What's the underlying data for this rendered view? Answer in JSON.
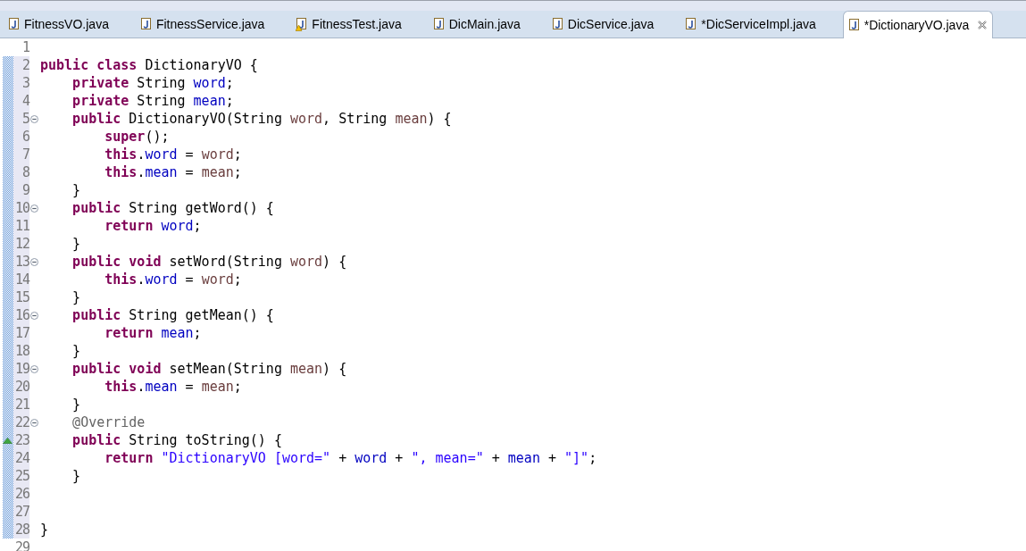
{
  "tabs": [
    {
      "label": "FitnessVO.java",
      "selected": false,
      "warning": false
    },
    {
      "label": "FitnessService.java",
      "selected": false,
      "warning": false
    },
    {
      "label": "FitnessTest.java",
      "selected": false,
      "warning": true
    },
    {
      "label": "DicMain.java",
      "selected": false,
      "warning": false
    },
    {
      "label": "DicService.java",
      "selected": false,
      "warning": false
    },
    {
      "label": "*DicServiceImpl.java",
      "selected": false,
      "warning": false
    },
    {
      "label": "*DictionaryVO.java",
      "selected": true,
      "warning": false
    }
  ],
  "editor": {
    "lines": [
      {
        "number": "1",
        "changed": false,
        "foldable": false,
        "override": false
      },
      {
        "number": "2",
        "changed": true,
        "foldable": false,
        "override": false,
        "tokens": [
          {
            "kind": "keyword",
            "text": "public class"
          },
          {
            "kind": "plain",
            "text": " DictionaryVO {"
          }
        ]
      },
      {
        "number": "3",
        "changed": true,
        "foldable": false,
        "override": false,
        "tokens": [
          {
            "kind": "keyword",
            "text": "    private"
          },
          {
            "kind": "plain",
            "text": " String "
          },
          {
            "kind": "field",
            "text": "word"
          },
          {
            "kind": "plain",
            "text": ";"
          }
        ]
      },
      {
        "number": "4",
        "changed": true,
        "foldable": false,
        "override": false,
        "tokens": [
          {
            "kind": "keyword",
            "text": "    private"
          },
          {
            "kind": "plain",
            "text": " String "
          },
          {
            "kind": "field",
            "text": "mean"
          },
          {
            "kind": "plain",
            "text": ";"
          }
        ]
      },
      {
        "number": "5",
        "changed": true,
        "foldable": true,
        "override": false,
        "tokens": [
          {
            "kind": "keyword",
            "text": "    public"
          },
          {
            "kind": "plain",
            "text": " DictionaryVO(String "
          },
          {
            "kind": "param",
            "text": "word"
          },
          {
            "kind": "plain",
            "text": ", String "
          },
          {
            "kind": "param",
            "text": "mean"
          },
          {
            "kind": "plain",
            "text": ") {"
          }
        ]
      },
      {
        "number": "6",
        "changed": true,
        "foldable": false,
        "override": false,
        "tokens": [
          {
            "kind": "keyword",
            "text": "        super"
          },
          {
            "kind": "plain",
            "text": "();"
          }
        ]
      },
      {
        "number": "7",
        "changed": true,
        "foldable": false,
        "override": false,
        "tokens": [
          {
            "kind": "keyword",
            "text": "        this"
          },
          {
            "kind": "plain",
            "text": "."
          },
          {
            "kind": "field",
            "text": "word"
          },
          {
            "kind": "plain",
            "text": " = "
          },
          {
            "kind": "param",
            "text": "word"
          },
          {
            "kind": "plain",
            "text": ";"
          }
        ]
      },
      {
        "number": "8",
        "changed": true,
        "foldable": false,
        "override": false,
        "tokens": [
          {
            "kind": "keyword",
            "text": "        this"
          },
          {
            "kind": "plain",
            "text": "."
          },
          {
            "kind": "field",
            "text": "mean"
          },
          {
            "kind": "plain",
            "text": " = "
          },
          {
            "kind": "param",
            "text": "mean"
          },
          {
            "kind": "plain",
            "text": ";"
          }
        ]
      },
      {
        "number": "9",
        "changed": true,
        "foldable": false,
        "override": false,
        "tokens": [
          {
            "kind": "plain",
            "text": "    }"
          }
        ]
      },
      {
        "number": "10",
        "changed": true,
        "foldable": true,
        "override": false,
        "tokens": [
          {
            "kind": "keyword",
            "text": "    public"
          },
          {
            "kind": "plain",
            "text": " String getWord() {"
          }
        ]
      },
      {
        "number": "11",
        "changed": true,
        "foldable": false,
        "override": false,
        "tokens": [
          {
            "kind": "keyword",
            "text": "        return"
          },
          {
            "kind": "field",
            "text": " word"
          },
          {
            "kind": "plain",
            "text": ";"
          }
        ]
      },
      {
        "number": "12",
        "changed": true,
        "foldable": false,
        "override": false,
        "tokens": [
          {
            "kind": "plain",
            "text": "    }"
          }
        ]
      },
      {
        "number": "13",
        "changed": true,
        "foldable": true,
        "override": false,
        "tokens": [
          {
            "kind": "keyword",
            "text": "    public void"
          },
          {
            "kind": "plain",
            "text": " setWord(String "
          },
          {
            "kind": "param",
            "text": "word"
          },
          {
            "kind": "plain",
            "text": ") {"
          }
        ]
      },
      {
        "number": "14",
        "changed": true,
        "foldable": false,
        "override": false,
        "tokens": [
          {
            "kind": "keyword",
            "text": "        this"
          },
          {
            "kind": "plain",
            "text": "."
          },
          {
            "kind": "field",
            "text": "word"
          },
          {
            "kind": "plain",
            "text": " = "
          },
          {
            "kind": "param",
            "text": "word"
          },
          {
            "kind": "plain",
            "text": ";"
          }
        ]
      },
      {
        "number": "15",
        "changed": true,
        "foldable": false,
        "override": false,
        "tokens": [
          {
            "kind": "plain",
            "text": "    }"
          }
        ]
      },
      {
        "number": "16",
        "changed": true,
        "foldable": true,
        "override": false,
        "tokens": [
          {
            "kind": "keyword",
            "text": "    public"
          },
          {
            "kind": "plain",
            "text": " String getMean() {"
          }
        ]
      },
      {
        "number": "17",
        "changed": true,
        "foldable": false,
        "override": false,
        "tokens": [
          {
            "kind": "keyword",
            "text": "        return"
          },
          {
            "kind": "field",
            "text": " mean"
          },
          {
            "kind": "plain",
            "text": ";"
          }
        ]
      },
      {
        "number": "18",
        "changed": true,
        "foldable": false,
        "override": false,
        "tokens": [
          {
            "kind": "plain",
            "text": "    }"
          }
        ]
      },
      {
        "number": "19",
        "changed": true,
        "foldable": true,
        "override": false,
        "tokens": [
          {
            "kind": "keyword",
            "text": "    public void"
          },
          {
            "kind": "plain",
            "text": " setMean(String "
          },
          {
            "kind": "param",
            "text": "mean"
          },
          {
            "kind": "plain",
            "text": ") {"
          }
        ]
      },
      {
        "number": "20",
        "changed": true,
        "foldable": false,
        "override": false,
        "tokens": [
          {
            "kind": "keyword",
            "text": "        this"
          },
          {
            "kind": "plain",
            "text": "."
          },
          {
            "kind": "field",
            "text": "mean"
          },
          {
            "kind": "plain",
            "text": " = "
          },
          {
            "kind": "param",
            "text": "mean"
          },
          {
            "kind": "plain",
            "text": ";"
          }
        ]
      },
      {
        "number": "21",
        "changed": true,
        "foldable": false,
        "override": false,
        "tokens": [
          {
            "kind": "plain",
            "text": "    }"
          }
        ]
      },
      {
        "number": "22",
        "changed": true,
        "foldable": true,
        "override": false,
        "tokens": [
          {
            "kind": "annotation",
            "text": "    @Override"
          }
        ]
      },
      {
        "number": "23",
        "changed": true,
        "foldable": false,
        "override": true,
        "tokens": [
          {
            "kind": "keyword",
            "text": "    public"
          },
          {
            "kind": "plain",
            "text": " String toString() {"
          }
        ]
      },
      {
        "number": "24",
        "changed": true,
        "foldable": false,
        "override": false,
        "tokens": [
          {
            "kind": "keyword",
            "text": "        return"
          },
          {
            "kind": "string",
            "text": " \"DictionaryVO [word=\""
          },
          {
            "kind": "plain",
            "text": " + "
          },
          {
            "kind": "field",
            "text": "word"
          },
          {
            "kind": "plain",
            "text": " + "
          },
          {
            "kind": "string",
            "text": "\", mean=\""
          },
          {
            "kind": "plain",
            "text": " + "
          },
          {
            "kind": "field",
            "text": "mean"
          },
          {
            "kind": "plain",
            "text": " + "
          },
          {
            "kind": "string",
            "text": "\"]\""
          },
          {
            "kind": "plain",
            "text": ";"
          }
        ]
      },
      {
        "number": "25",
        "changed": true,
        "foldable": false,
        "override": false,
        "tokens": [
          {
            "kind": "plain",
            "text": "    }"
          }
        ]
      },
      {
        "number": "26",
        "changed": true,
        "foldable": false,
        "override": false
      },
      {
        "number": "27",
        "changed": true,
        "foldable": false,
        "override": false
      },
      {
        "number": "28",
        "changed": true,
        "foldable": false,
        "override": false,
        "tokens": [
          {
            "kind": "plain",
            "text": "}"
          }
        ]
      },
      {
        "number": "29",
        "changed": false,
        "foldable": false,
        "override": false
      }
    ]
  }
}
